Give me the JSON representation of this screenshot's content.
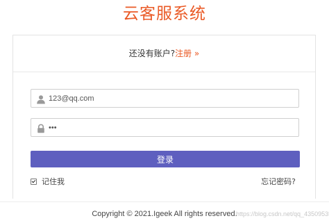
{
  "app": {
    "title": "云客服系统"
  },
  "register": {
    "prompt": "还没有账户?",
    "link_label": "注册 »"
  },
  "form": {
    "email": {
      "value": "123@qq.com",
      "icon": "user-icon"
    },
    "password": {
      "value": "•••",
      "icon": "lock-icon"
    },
    "login_label": "登录",
    "remember_label": "记住我",
    "remember_checked": true,
    "forgot_label": "忘记密码?"
  },
  "footer": {
    "copyright": "Copyright © 2021.Igeek All rights reserved.",
    "watermark": "https://blog.csdn.net/qq_43509535"
  },
  "colors": {
    "accent": "#ea5a26",
    "button": "#5e5fbf"
  }
}
